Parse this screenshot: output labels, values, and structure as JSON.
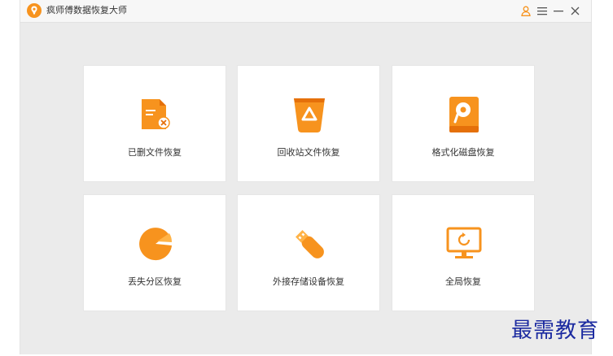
{
  "app": {
    "title": "疯师傅数据恢复大师"
  },
  "cards": [
    {
      "label": "已删文件恢复",
      "icon": "deleted-file-icon"
    },
    {
      "label": "回收站文件恢复",
      "icon": "recycle-bin-icon"
    },
    {
      "label": "格式化磁盘恢复",
      "icon": "format-disk-icon"
    },
    {
      "label": "丢失分区恢复",
      "icon": "lost-partition-icon"
    },
    {
      "label": "外接存储设备恢复",
      "icon": "usb-drive-icon"
    },
    {
      "label": "全局恢复",
      "icon": "monitor-refresh-icon"
    }
  ],
  "colors": {
    "accent": "#f7931e",
    "accent_dark": "#e5700a",
    "accent_light": "#ffb347"
  },
  "watermark": "最需教育"
}
